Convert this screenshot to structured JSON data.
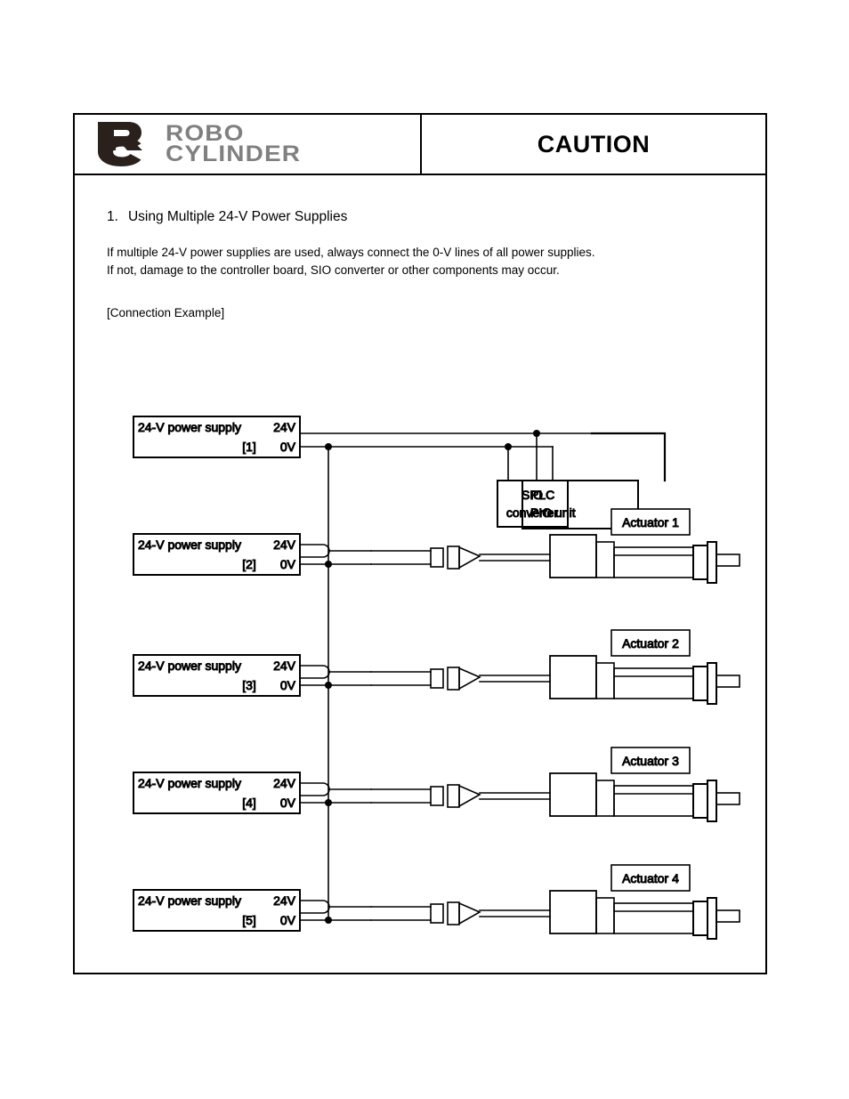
{
  "header": {
    "logo_mark": "rc-monogram",
    "brand_line1": "ROBO",
    "brand_line2": "CYLINDER",
    "brand_color": "#808080",
    "mark_color": "#2b211c",
    "title": "CAUTION"
  },
  "content": {
    "heading_number": "1.",
    "heading_text": "Using Multiple 24-V Power Supplies",
    "paragraph_line1": "If multiple 24-V power supplies are used, always connect the 0-V lines of all power supplies.",
    "paragraph_line2": "If not, damage to the controller board, SIO converter or other components may occur.",
    "example_label": "[Connection Example]"
  },
  "diagram": {
    "supply_label": "24-V power supply",
    "terminal_24v": "24V",
    "terminal_0v": "0V",
    "power_supplies": [
      {
        "index": "[1]"
      },
      {
        "index": "[2]"
      },
      {
        "index": "[3]"
      },
      {
        "index": "[4]"
      },
      {
        "index": "[5]"
      }
    ],
    "devices": [
      {
        "name": "sio-converter",
        "line1": "SIO",
        "line2": "converter"
      },
      {
        "name": "plc-pio-unit",
        "line1": "PLC",
        "line2": "PIO unit"
      }
    ],
    "actuators": [
      {
        "label": "Actuator 1"
      },
      {
        "label": "Actuator 2"
      },
      {
        "label": "Actuator 3"
      },
      {
        "label": "Actuator 4"
      }
    ]
  }
}
